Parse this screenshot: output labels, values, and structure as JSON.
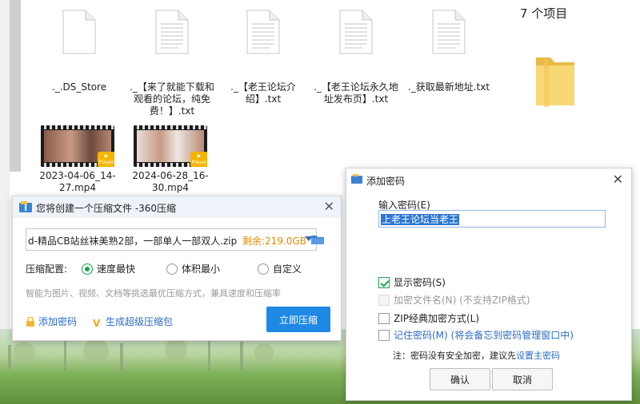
{
  "explorer": {
    "item_count": "7 个项目",
    "files": [
      {
        "name": "._.DS_Store"
      },
      {
        "name": "._【来了就能下载和观看的论坛，纯免费！】.txt"
      },
      {
        "name": "._【老王论坛介绍】.txt"
      },
      {
        "name": "._【老王论坛永久地址发布页】.txt"
      },
      {
        "name": "._获取最新地址.txt"
      }
    ],
    "videos": [
      {
        "name": "2023-04-06_14-27.mp4",
        "badge": "Player"
      },
      {
        "name": "2024-06-28_16-30.mp4",
        "badge": "Player"
      }
    ]
  },
  "zip_dialog": {
    "title": "您将创建一个压缩文件 -360压缩",
    "close": "✕",
    "path": "d-精品CB站丝袜美熟2部，一部单人一部双人.zip",
    "remaining": "剩余:219.0GB",
    "config_label": "压缩配置:",
    "options": [
      "速度最快",
      "体积最小",
      "自定义"
    ],
    "selected_option": "速度最快",
    "hint": "智能为图片、视频、文档等挑选最优压缩方式，兼具速度和压缩率",
    "add_password": "添加密码",
    "super_package": "生成超级压缩包",
    "compress_now": "立即压缩"
  },
  "password_dialog": {
    "title": "添加密码",
    "close": "✕",
    "input_label": "输入密码(E)",
    "password_value": "上老王论坛当老王",
    "show_password": "显示密码(S)",
    "encrypt_filename": "加密文件名(N) (不支持ZIP格式)",
    "zip_classic": "ZIP经典加密方式(L)",
    "remember": "记住密码(M) (将会备忘到密码管理窗口中)",
    "note": "注：密码没有安全加密，建议先",
    "note_link": "设置主密码",
    "ok": "确认",
    "cancel": "取消"
  },
  "colors": {
    "accent": "#1e88e5",
    "link": "#2b6cc4",
    "checked": "#1aa34a",
    "remaining": "#e08a00"
  }
}
